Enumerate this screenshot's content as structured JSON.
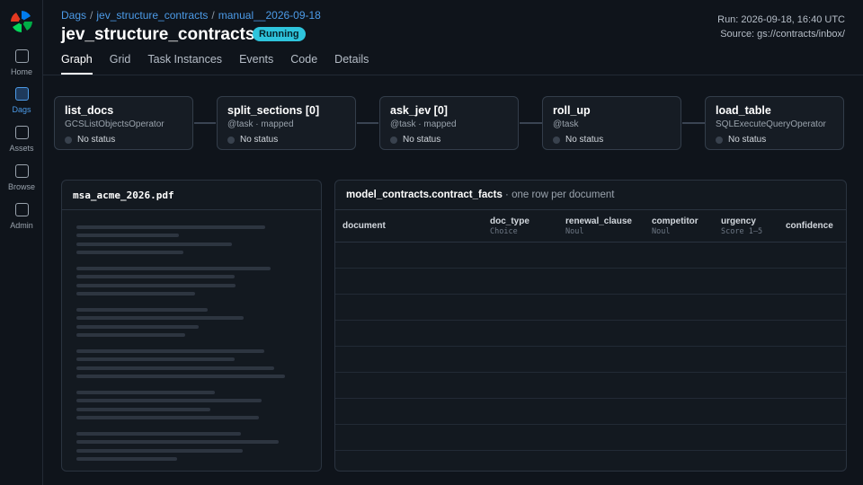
{
  "sidebar": {
    "items": [
      {
        "label": "Home",
        "active": false
      },
      {
        "label": "Dags",
        "active": true
      },
      {
        "label": "Assets",
        "active": false
      },
      {
        "label": "Browse",
        "active": false
      },
      {
        "label": "Admin",
        "active": false
      }
    ]
  },
  "breadcrumb": [
    "Dags",
    "jev_structure_contracts",
    "manual__2026-09-18"
  ],
  "header": {
    "title": "jev_structure_contracts",
    "status": "Running",
    "run": "Run: 2026-09-18, 16:40 UTC",
    "source": "Source: gs://contracts/inbox/"
  },
  "tabs": [
    "Graph",
    "Grid",
    "Task Instances",
    "Events",
    "Code",
    "Details"
  ],
  "active_tab": "Graph",
  "nodes": [
    {
      "name": "list_docs",
      "sub": "GCSListObjectsOperator",
      "status": "No status"
    },
    {
      "name": "split_sections [0]",
      "sub": "@task · mapped",
      "status": "No status"
    },
    {
      "name": "ask_jev [0]",
      "sub": "@task · mapped",
      "status": "No status"
    },
    {
      "name": "roll_up",
      "sub": "@task",
      "status": "No status"
    },
    {
      "name": "load_table",
      "sub": "SQLExecuteQueryOperator",
      "status": "No status"
    }
  ],
  "document": {
    "filename": "msa_acme_2026.pdf"
  },
  "table": {
    "name": "model_contracts.contract_facts",
    "description": " · one row per document",
    "columns": [
      {
        "name": "document",
        "type": ""
      },
      {
        "name": "doc_type",
        "type": "Choice"
      },
      {
        "name": "renewal_clause",
        "type": "Noul"
      },
      {
        "name": "competitor",
        "type": "Noul"
      },
      {
        "name": "urgency",
        "type": "Score 1–5"
      },
      {
        "name": "confidence",
        "type": ""
      }
    ],
    "row_count": 9
  },
  "colors": {
    "accent": "#4c9be8",
    "status_running": "#2ec4dc",
    "background": "#0f141b"
  }
}
